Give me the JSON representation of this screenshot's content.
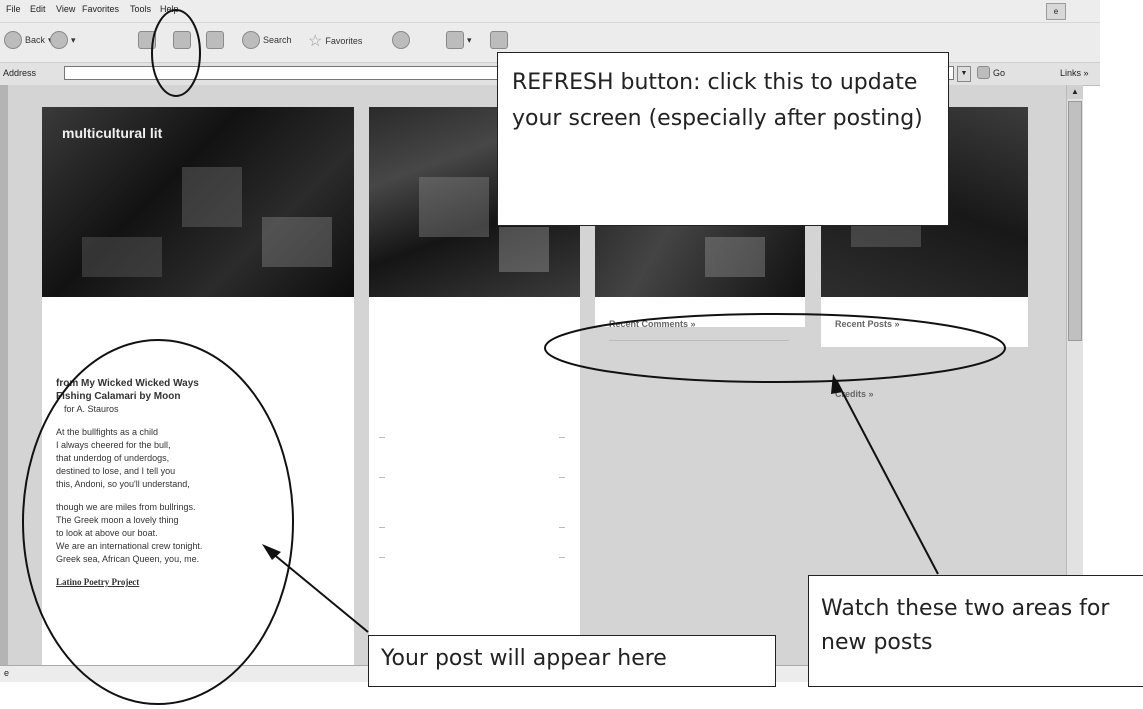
{
  "menu": {
    "file": "File",
    "edit": "Edit",
    "view": "View",
    "favorites": "Favorites",
    "tools": "Tools",
    "help": "Help"
  },
  "toolbar": {
    "back": "Back",
    "search": "Search",
    "favorites": "Favorites"
  },
  "address": {
    "label": "Address",
    "go": "Go",
    "links": "Links »"
  },
  "blog": {
    "title": "multicultural lit"
  },
  "post": {
    "title_line1": "from My Wicked Wicked Ways",
    "title_line2": "Fishing Calamari by Moon",
    "dedication": "for A. Stauros",
    "stanza1": [
      "At the bullfights as a child",
      "I always cheered for the bull,",
      "that underdog of underdogs,",
      "destined to lose, and I tell you",
      "this, Andoni, so you'll understand,"
    ],
    "stanza2": [
      "though we are miles from bullrings.",
      "The Greek moon a lovely thing",
      "to look at above our boat.",
      "We are an international crew tonight.",
      "Greek sea, African Queen, you, me."
    ],
    "link": "Latino Poetry Project"
  },
  "sidebar": {
    "recent_comments": "Recent Comments »",
    "recent_posts": "Recent Posts »",
    "credits": "Credits »"
  },
  "annotations": {
    "refresh": "REFRESH button: click this to update your screen (especially after posting)",
    "post": "Your post will appear here",
    "watch": "Watch these two areas for new posts"
  },
  "colors": {
    "annotation_stroke": "#111111",
    "chrome": "#ececec",
    "page_bg": "#d4d4d4"
  }
}
